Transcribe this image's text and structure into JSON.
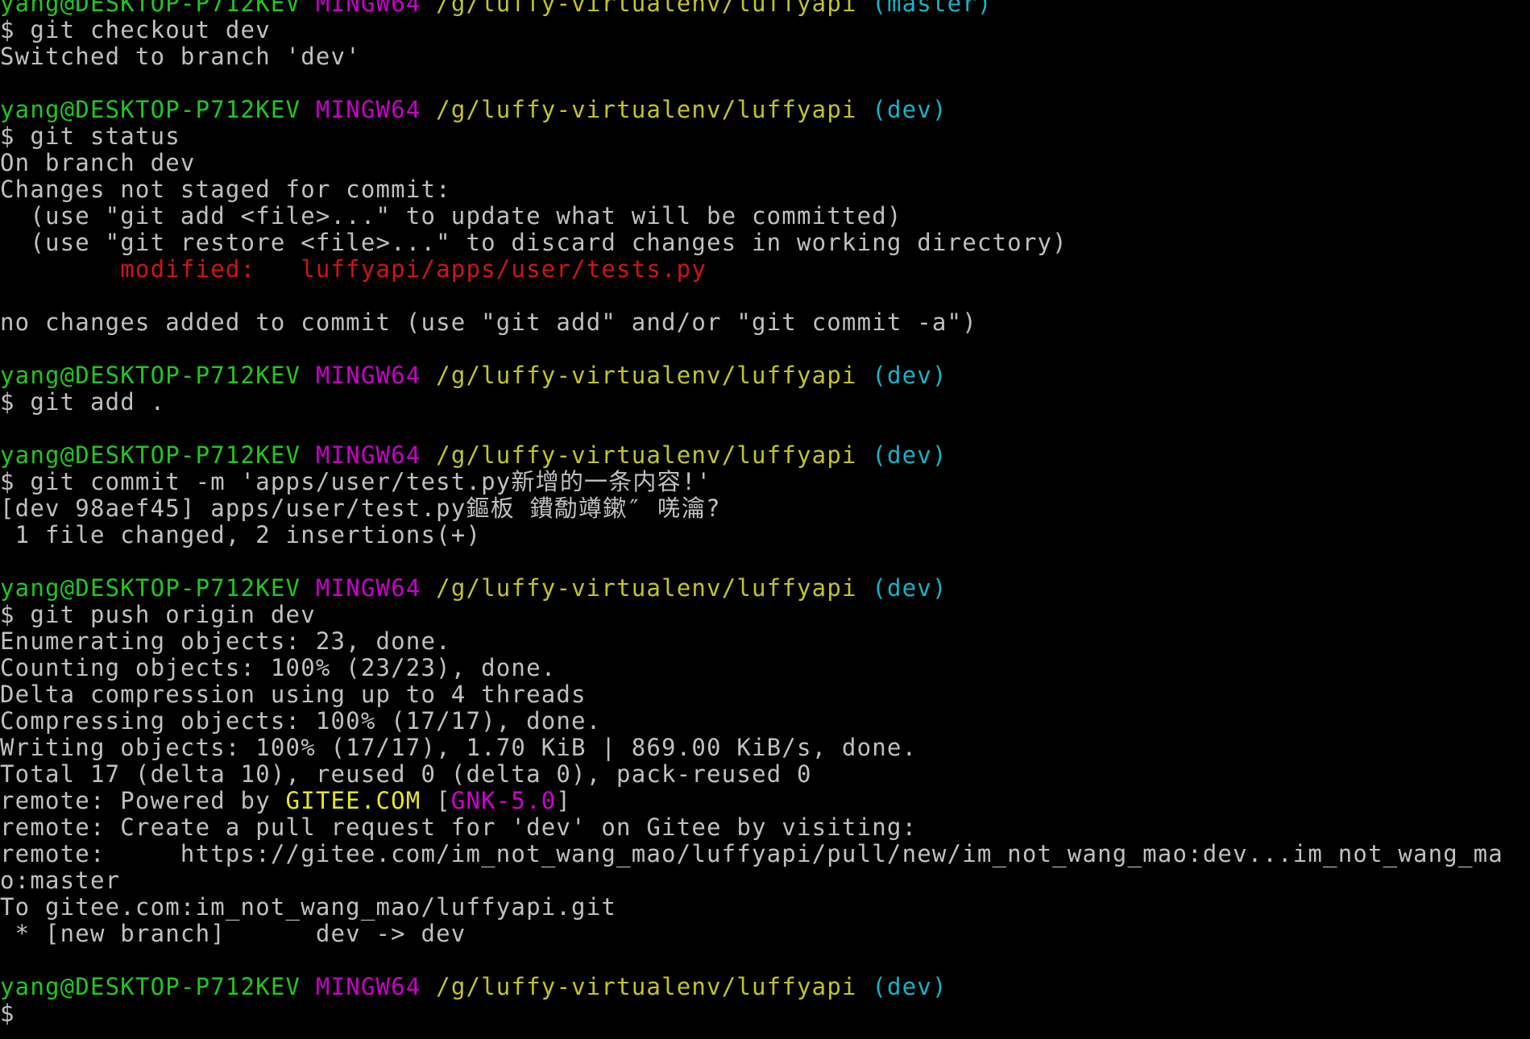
{
  "colors": {
    "background": "#000000",
    "text": "#c0c0c0",
    "prompt_user": "#1fc71f",
    "prompt_env": "#c800c8",
    "prompt_path": "#c3c325",
    "prompt_branch": "#14b4c8",
    "git_modified": "#d01414",
    "gitee_brand": "#e8e81e",
    "gitee_version": "#d000d0"
  },
  "prompt": {
    "user_host": "yang@DESKTOP-P712KEV",
    "env": "MINGW64",
    "path": "/g/luffy-virtualenv/luffyapi"
  },
  "lines": [
    {
      "type": "prompt",
      "branch": "(master)"
    },
    {
      "type": "text",
      "segments": [
        {
          "text": "$ git checkout dev"
        }
      ]
    },
    {
      "type": "text",
      "segments": [
        {
          "text": "Switched to branch 'dev'"
        }
      ]
    },
    {
      "type": "text",
      "segments": [
        {
          "text": ""
        }
      ]
    },
    {
      "type": "prompt",
      "branch": "(dev)"
    },
    {
      "type": "text",
      "segments": [
        {
          "text": "$ git status"
        }
      ]
    },
    {
      "type": "text",
      "segments": [
        {
          "text": "On branch dev"
        }
      ]
    },
    {
      "type": "text",
      "segments": [
        {
          "text": "Changes not staged for commit:"
        }
      ]
    },
    {
      "type": "text",
      "segments": [
        {
          "text": "  (use \"git add <file>...\" to update what will be committed)"
        }
      ]
    },
    {
      "type": "text",
      "segments": [
        {
          "text": "  (use \"git restore <file>...\" to discard changes in working directory)"
        }
      ]
    },
    {
      "type": "text",
      "segments": [
        {
          "text": "        modified:   luffyapi/apps/user/tests.py",
          "color": "#d01414"
        }
      ]
    },
    {
      "type": "text",
      "segments": [
        {
          "text": ""
        }
      ]
    },
    {
      "type": "text",
      "segments": [
        {
          "text": "no changes added to commit (use \"git add\" and/or \"git commit -a\")"
        }
      ]
    },
    {
      "type": "text",
      "segments": [
        {
          "text": ""
        }
      ]
    },
    {
      "type": "prompt",
      "branch": "(dev)"
    },
    {
      "type": "text",
      "segments": [
        {
          "text": "$ git add ."
        }
      ]
    },
    {
      "type": "text",
      "segments": [
        {
          "text": ""
        }
      ]
    },
    {
      "type": "prompt",
      "branch": "(dev)"
    },
    {
      "type": "text",
      "segments": [
        {
          "text": "$ git commit -m 'apps/user/test.py新增的一条内容!'"
        }
      ]
    },
    {
      "type": "text",
      "segments": [
        {
          "text": "[dev 98aef45] apps/user/test.py鏂板 鐨勪竴鏉″ 唴瀹?"
        }
      ]
    },
    {
      "type": "text",
      "segments": [
        {
          "text": " 1 file changed, 2 insertions(+)"
        }
      ]
    },
    {
      "type": "text",
      "segments": [
        {
          "text": ""
        }
      ]
    },
    {
      "type": "prompt",
      "branch": "(dev)"
    },
    {
      "type": "text",
      "segments": [
        {
          "text": "$ git push origin dev"
        }
      ]
    },
    {
      "type": "text",
      "segments": [
        {
          "text": "Enumerating objects: 23, done."
        }
      ]
    },
    {
      "type": "text",
      "segments": [
        {
          "text": "Counting objects: 100% (23/23), done."
        }
      ]
    },
    {
      "type": "text",
      "segments": [
        {
          "text": "Delta compression using up to 4 threads"
        }
      ]
    },
    {
      "type": "text",
      "segments": [
        {
          "text": "Compressing objects: 100% (17/17), done."
        }
      ]
    },
    {
      "type": "text",
      "segments": [
        {
          "text": "Writing objects: 100% (17/17), 1.70 KiB | 869.00 KiB/s, done."
        }
      ]
    },
    {
      "type": "text",
      "segments": [
        {
          "text": "Total 17 (delta 10), reused 0 (delta 0), pack-reused 0"
        }
      ]
    },
    {
      "type": "text",
      "segments": [
        {
          "text": "remote: Powered by "
        },
        {
          "text": "GITEE.COM",
          "color": "#e8e81e"
        },
        {
          "text": " ["
        },
        {
          "text": "GNK-5.0",
          "color": "#d000d0"
        },
        {
          "text": "]"
        }
      ]
    },
    {
      "type": "text",
      "segments": [
        {
          "text": "remote: Create a pull request for 'dev' on Gitee by visiting:"
        }
      ]
    },
    {
      "type": "text",
      "segments": [
        {
          "text": "remote:     https://gitee.com/im_not_wang_mao/luffyapi/pull/new/im_not_wang_mao:dev...im_not_wang_ma"
        }
      ]
    },
    {
      "type": "text",
      "segments": [
        {
          "text": "o:master"
        }
      ]
    },
    {
      "type": "text",
      "segments": [
        {
          "text": "To gitee.com:im_not_wang_mao/luffyapi.git"
        }
      ]
    },
    {
      "type": "text",
      "segments": [
        {
          "text": " * [new branch]      dev -> dev"
        }
      ]
    },
    {
      "type": "text",
      "segments": [
        {
          "text": ""
        }
      ]
    },
    {
      "type": "prompt",
      "branch": "(dev)"
    },
    {
      "type": "input",
      "segments": [
        {
          "text": "$ "
        }
      ]
    }
  ]
}
